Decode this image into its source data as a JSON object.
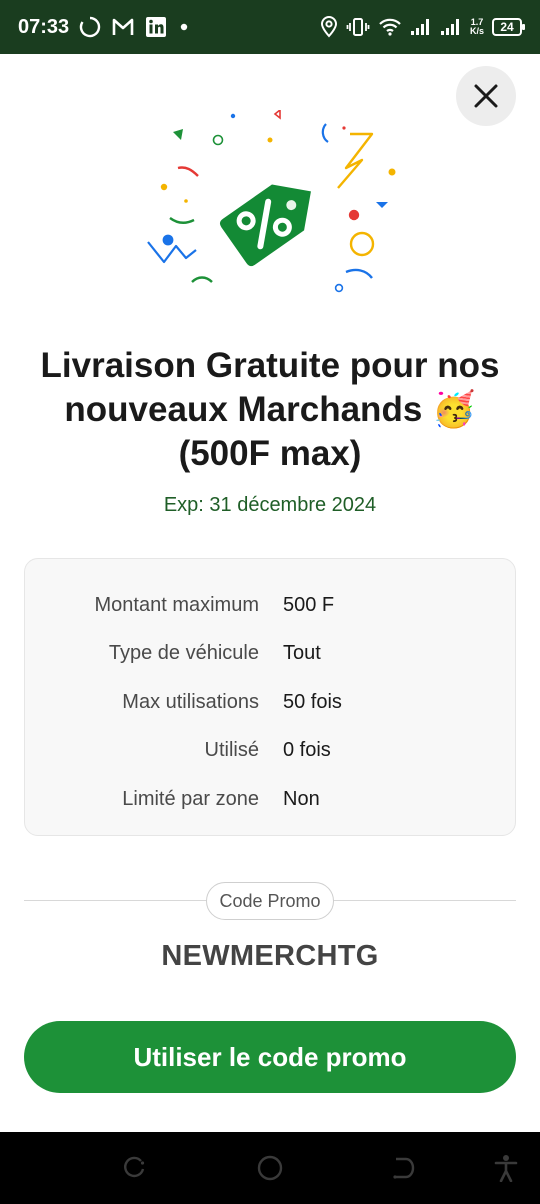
{
  "status_bar": {
    "time": "07:33",
    "network_speed_value": "1.7",
    "network_speed_unit": "K/s",
    "battery": "24",
    "icons": [
      "loading-circle-icon",
      "gmail-icon",
      "linkedin-icon",
      "dot-icon",
      "location-icon",
      "vibrate-icon",
      "wifi-icon",
      "signal-icon",
      "signal-icon-2",
      "battery-icon"
    ]
  },
  "sheet": {
    "close_icon": "close-icon",
    "hero_icon": "discount-tag-icon",
    "title_line1": "Livraison Gratuite pour nos",
    "title_line2": "nouveaux Marchands 🥳",
    "title_line3": "(500F max)",
    "expiry": "Exp: 31 décembre 2024",
    "details": [
      {
        "label": "Montant maximum",
        "value": "500 F"
      },
      {
        "label": "Type de véhicule",
        "value": "Tout"
      },
      {
        "label": "Max utilisations",
        "value": "50 fois"
      },
      {
        "label": "Utilisé",
        "value": "0 fois"
      },
      {
        "label": "Limité par zone",
        "value": "Non"
      }
    ],
    "promo_label": "Code Promo",
    "promo_code": "NEWMERCHTG",
    "use_button": "Utiliser le code promo"
  },
  "nav_bar": {
    "icons": [
      "recent-apps-icon",
      "home-icon",
      "back-icon",
      "accessibility-icon"
    ]
  },
  "colors": {
    "status_bar_bg": "#1a3d1f",
    "primary_green": "#1d9138",
    "expiry_green": "#1f5e27"
  }
}
